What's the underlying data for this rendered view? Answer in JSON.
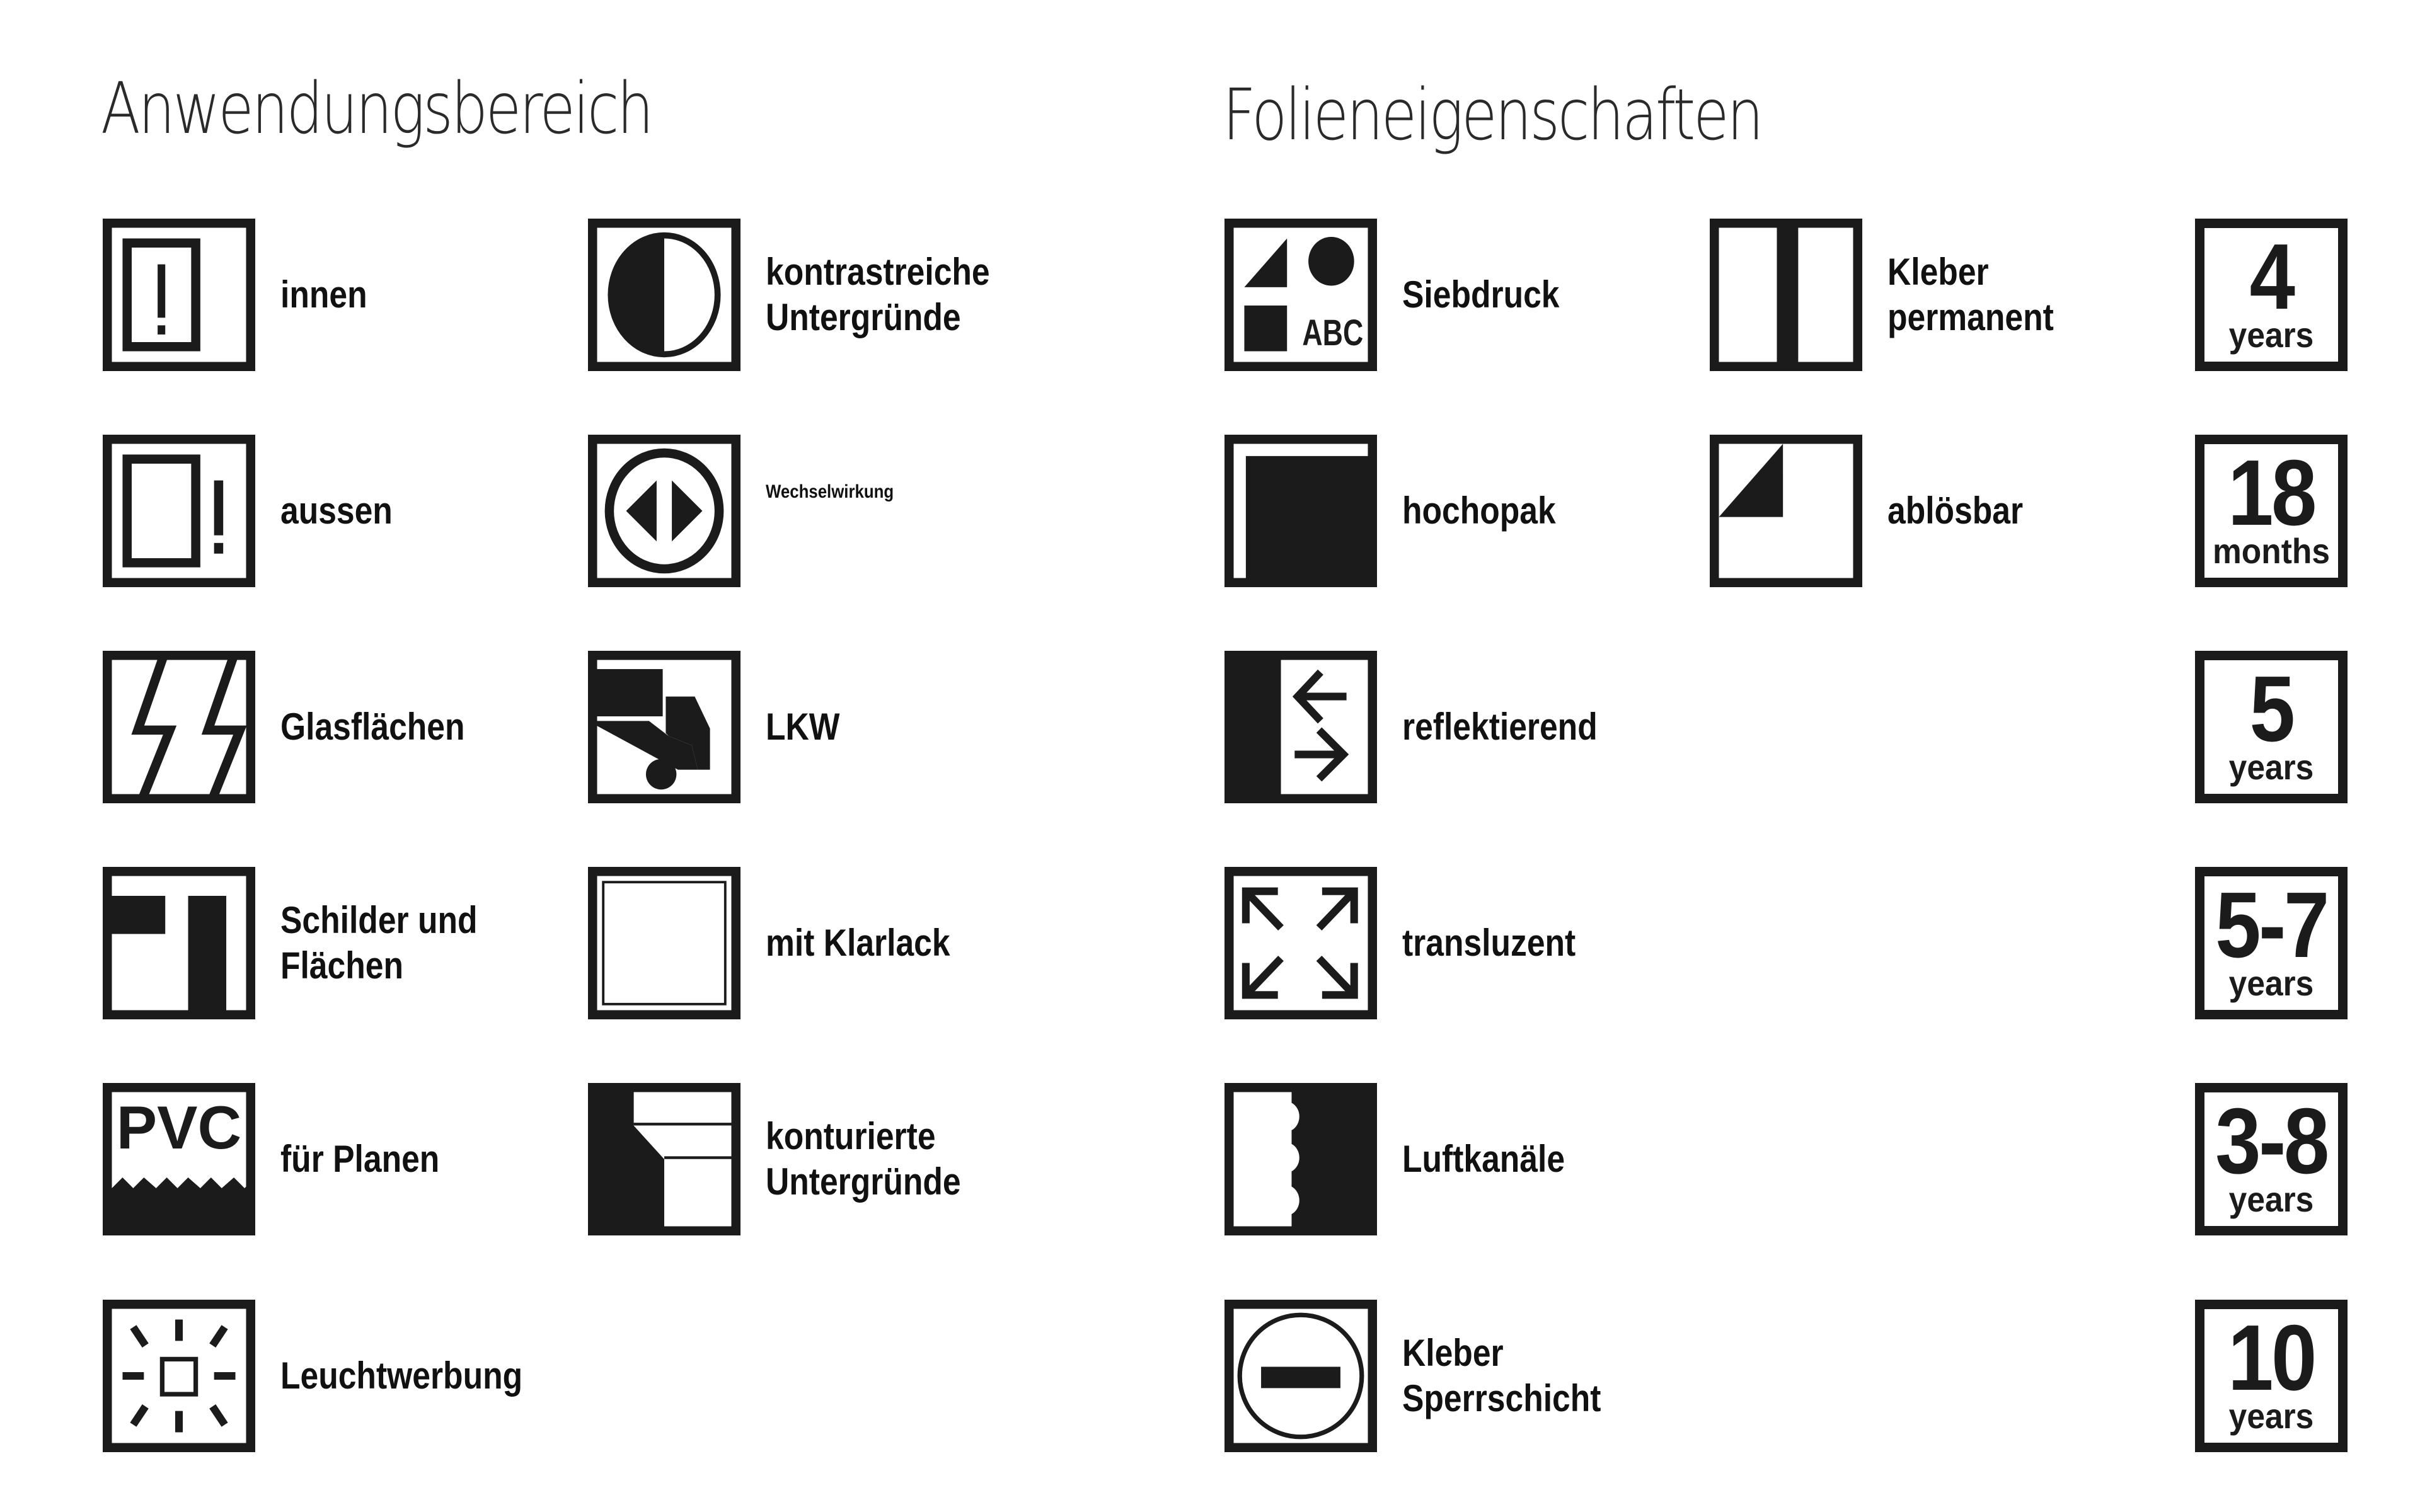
{
  "sections": {
    "application": {
      "title": "Anwendungsbereich",
      "items": [
        {
          "icon": "indoor-icon",
          "label_lines": [
            "innen"
          ]
        },
        {
          "icon": "outdoor-icon",
          "label_lines": [
            "aussen"
          ]
        },
        {
          "icon": "glass-surfaces-icon",
          "label_lines": [
            "Glasflächen"
          ]
        },
        {
          "icon": "signs-surfaces-icon",
          "label_lines": [
            "Schilder und",
            "Flächen"
          ]
        },
        {
          "icon": "pvc-tarpaulin-icon",
          "icon_text": "PVC",
          "label_lines": [
            "für Planen"
          ]
        },
        {
          "icon": "illuminated-advertising-icon",
          "label_lines": [
            "Leuchtwerbung"
          ]
        },
        {
          "icon": "high-contrast-icon",
          "label_lines": [
            "kontrastreiche",
            "Untergründe"
          ]
        },
        {
          "icon": "interaction-icon",
          "label_lines": [
            "Wechselwirkung"
          ]
        },
        {
          "icon": "truck-icon",
          "label_lines": [
            "LKW"
          ]
        },
        {
          "icon": "clear-coat-icon",
          "label_lines": [
            "mit Klarlack"
          ]
        },
        {
          "icon": "contoured-surfaces-icon",
          "label_lines": [
            "konturierte",
            "Untergründe"
          ]
        }
      ]
    },
    "film_properties": {
      "title": "Folieneigenschaften",
      "items": [
        {
          "icon": "screen-printing-icon",
          "icon_text": "ABC",
          "label_lines": [
            "Siebdruck"
          ]
        },
        {
          "icon": "high-opacity-icon",
          "label_lines": [
            "hochopak"
          ]
        },
        {
          "icon": "reflective-icon",
          "label_lines": [
            "reflektierend"
          ]
        },
        {
          "icon": "translucent-icon",
          "label_lines": [
            "transluzent"
          ]
        },
        {
          "icon": "air-channels-icon",
          "label_lines": [
            "Luftkanäle"
          ]
        },
        {
          "icon": "adhesive-barrier-icon",
          "label_lines": [
            "Kleber",
            "Sperrschicht"
          ]
        },
        {
          "icon": "permanent-adhesive-icon",
          "label_lines": [
            "Kleber",
            "permanent"
          ]
        },
        {
          "icon": "removable-icon",
          "label_lines": [
            "ablösbar"
          ]
        }
      ],
      "durability": [
        {
          "value": "4",
          "unit": "years"
        },
        {
          "value": "18",
          "unit": "months"
        },
        {
          "value": "5",
          "unit": "years"
        },
        {
          "value": "5-7",
          "unit": "years"
        },
        {
          "value": "3-8",
          "unit": "years"
        },
        {
          "value": "10",
          "unit": "years"
        }
      ]
    }
  },
  "colors": {
    "ink": "#1b1b1b",
    "background": "#ffffff"
  }
}
